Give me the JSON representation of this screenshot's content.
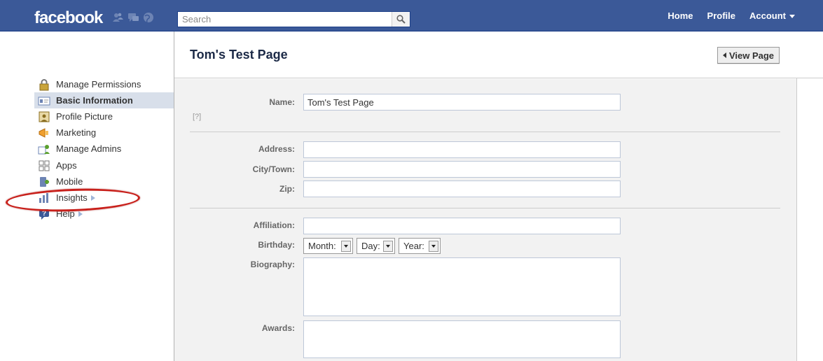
{
  "topbar": {
    "logo": "facebook",
    "search_placeholder": "Search",
    "nav": [
      "Home",
      "Profile",
      "Account"
    ]
  },
  "sidebar": {
    "items": [
      {
        "label": "Manage Permissions",
        "icon": "lock-icon"
      },
      {
        "label": "Basic Information",
        "icon": "id-card-icon",
        "active": true
      },
      {
        "label": "Profile Picture",
        "icon": "picture-icon"
      },
      {
        "label": "Marketing",
        "icon": "megaphone-icon"
      },
      {
        "label": "Manage Admins",
        "icon": "admins-icon"
      },
      {
        "label": "Apps",
        "icon": "apps-icon"
      },
      {
        "label": "Mobile",
        "icon": "mobile-icon"
      },
      {
        "label": "Insights",
        "icon": "bar-chart-icon",
        "arrow": true
      },
      {
        "label": "Help",
        "icon": "help-icon",
        "arrow": true
      }
    ]
  },
  "page": {
    "title": "Tom's Test Page",
    "view_button": "View Page",
    "help_hint": "[?]"
  },
  "form": {
    "name_label": "Name:",
    "name_value": "Tom's Test Page",
    "address_label": "Address:",
    "city_label": "City/Town:",
    "zip_label": "Zip:",
    "affiliation_label": "Affiliation:",
    "birthday_label": "Birthday:",
    "month": "Month:",
    "day": "Day:",
    "year": "Year:",
    "biography_label": "Biography:",
    "awards_label": "Awards:"
  },
  "colors": {
    "brand": "#3b5998",
    "sidebar_active": "#d8dfea",
    "highlight_oval": "#c8201b"
  }
}
